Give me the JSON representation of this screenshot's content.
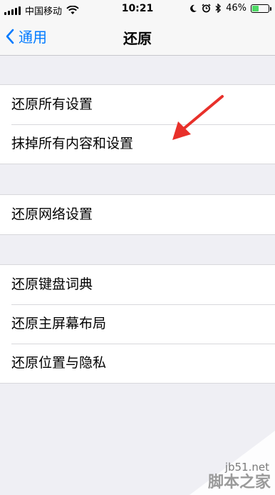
{
  "status_bar": {
    "carrier": "中国移动",
    "time": "10:21",
    "battery_percent": "46%",
    "battery_level": 0.46,
    "icons": [
      "signal-icon",
      "wifi-icon",
      "moon-icon",
      "alarm-icon",
      "bluetooth-icon",
      "battery-icon"
    ]
  },
  "nav": {
    "back_label": "通用",
    "title": "还原"
  },
  "groups": [
    {
      "items": [
        "还原所有设置",
        "抹掉所有内容和设置"
      ]
    },
    {
      "items": [
        "还原网络设置"
      ]
    },
    {
      "items": [
        "还原键盘词典",
        "还原主屏幕布局",
        "还原位置与隐私"
      ]
    }
  ],
  "watermark": {
    "site": "jb51.net",
    "name": "脚本之家"
  },
  "colors": {
    "accent": "#007aff",
    "background": "#efeff4",
    "arrow": "#e8302a",
    "battery": "#4cd964"
  }
}
